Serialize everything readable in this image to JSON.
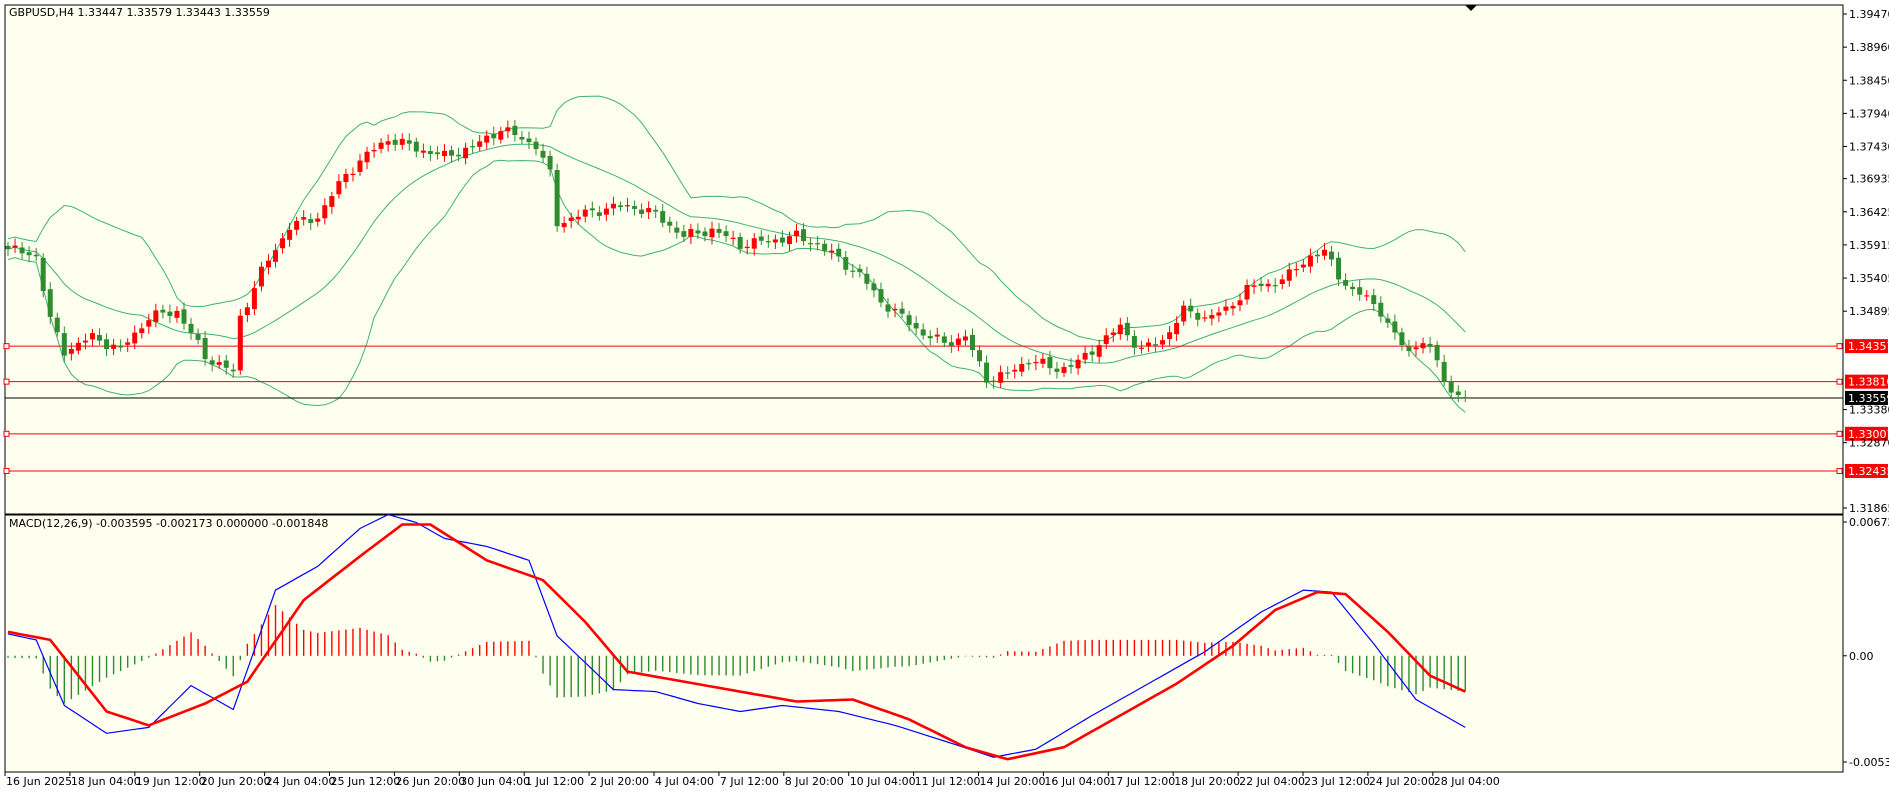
{
  "colors": {
    "background": "#fffff0",
    "bull": "#ff0000",
    "bear": "#2e8b2e",
    "bands": "#3cb371",
    "level": "#ff0000",
    "current_price": "#000000",
    "macd_line": "#0000ff",
    "signal_line": "#ff0000"
  },
  "chart_data": {
    "type": "candlestick",
    "symbol_header": "GBPUSD,H4  1.33447 1.33579 1.33443 1.33559",
    "ylim": [
      1.31865,
      1.3947
    ],
    "y_ticks": [
      "1.39470",
      "1.38960",
      "1.38450",
      "1.37940",
      "1.37430",
      "1.36935",
      "1.36425",
      "1.35915",
      "1.35405",
      "1.34895",
      "1.33380",
      "1.32870",
      "1.31865"
    ],
    "current_price": "1.33559",
    "levels": [
      "1.34357",
      "1.33810",
      "1.33007",
      "1.32435"
    ],
    "x_labels": [
      "16 Jun 2025",
      "18 Jun 04:00",
      "19 Jun 12:00",
      "20 Jun 20:00",
      "24 Jun 04:00",
      "25 Jun 12:00",
      "26 Jun 20:00",
      "30 Jun 04:00",
      "1 Jul 12:00",
      "2 Jul 20:00",
      "4 Jul 04:00",
      "7 Jul 12:00",
      "8 Jul 20:00",
      "10 Jul 04:00",
      "11 Jul 12:00",
      "14 Jul 20:00",
      "16 Jul 04:00",
      "17 Jul 12:00",
      "18 Jul 20:00",
      "22 Jul 04:00",
      "23 Jul 12:00",
      "24 Jul 20:00",
      "28 Jul 04:00"
    ],
    "close_keypoints": [
      [
        0,
        1.3585
      ],
      [
        4,
        1.3575
      ],
      [
        6,
        1.3475
      ],
      [
        8,
        1.3428
      ],
      [
        12,
        1.345
      ],
      [
        16,
        1.343
      ],
      [
        20,
        1.348
      ],
      [
        24,
        1.349
      ],
      [
        28,
        1.342
      ],
      [
        32,
        1.3395
      ],
      [
        33,
        1.348
      ],
      [
        36,
        1.355
      ],
      [
        40,
        1.362
      ],
      [
        44,
        1.3635
      ],
      [
        48,
        1.37
      ],
      [
        51,
        1.373
      ],
      [
        54,
        1.3755
      ],
      [
        58,
        1.374
      ],
      [
        62,
        1.3728
      ],
      [
        66,
        1.3742
      ],
      [
        70,
        1.377
      ],
      [
        72,
        1.376
      ],
      [
        75,
        1.3745
      ],
      [
        77,
        1.37
      ],
      [
        78,
        1.3625
      ],
      [
        82,
        1.364
      ],
      [
        86,
        1.365
      ],
      [
        89,
        1.365
      ],
      [
        92,
        1.3638
      ],
      [
        96,
        1.3605
      ],
      [
        100,
        1.3615
      ],
      [
        104,
        1.3592
      ],
      [
        108,
        1.3598
      ],
      [
        112,
        1.3605
      ],
      [
        115,
        1.3592
      ],
      [
        118,
        1.357
      ],
      [
        121,
        1.3545
      ],
      [
        124,
        1.3505
      ],
      [
        127,
        1.348
      ],
      [
        130,
        1.3455
      ],
      [
        133,
        1.344
      ],
      [
        136,
        1.345
      ],
      [
        139,
        1.3385
      ],
      [
        142,
        1.3392
      ],
      [
        145,
        1.3415
      ],
      [
        149,
        1.34
      ],
      [
        152,
        1.341
      ],
      [
        155,
        1.344
      ],
      [
        158,
        1.3465
      ],
      [
        161,
        1.343
      ],
      [
        164,
        1.3445
      ],
      [
        167,
        1.349
      ],
      [
        170,
        1.348
      ],
      [
        173,
        1.349
      ],
      [
        176,
        1.3525
      ],
      [
        179,
        1.353
      ],
      [
        182,
        1.3545
      ],
      [
        185,
        1.3575
      ],
      [
        187,
        1.358
      ],
      [
        189,
        1.3545
      ],
      [
        191,
        1.352
      ],
      [
        193,
        1.351
      ],
      [
        195,
        1.349
      ],
      [
        197,
        1.345
      ],
      [
        199,
        1.3428
      ],
      [
        201,
        1.3445
      ],
      [
        203,
        1.341
      ],
      [
        205,
        1.3365
      ],
      [
        207,
        1.3356
      ]
    ],
    "macd": {
      "label": "MACD(12,26,9) -0.003595 -0.002173 0.000000 -0.001848",
      "ylim": [
        -0.005342,
        0.006727
      ],
      "y_ticks": [
        "0.006727",
        "0.00",
        "-0.005342"
      ],
      "macd_keypoints": [
        [
          0,
          0.0011
        ],
        [
          4,
          0.0008
        ],
        [
          8,
          -0.0025
        ],
        [
          14,
          -0.0039
        ],
        [
          20,
          -0.0036
        ],
        [
          26,
          -0.0015
        ],
        [
          32,
          -0.0027
        ],
        [
          38,
          0.0033
        ],
        [
          44,
          0.0045
        ],
        [
          50,
          0.0064
        ],
        [
          54,
          0.0071
        ],
        [
          58,
          0.0067
        ],
        [
          62,
          0.0059
        ],
        [
          68,
          0.0055
        ],
        [
          74,
          0.0048
        ],
        [
          78,
          0.001
        ],
        [
          86,
          -0.0017
        ],
        [
          92,
          -0.0018
        ],
        [
          98,
          -0.0024
        ],
        [
          104,
          -0.0028
        ],
        [
          110,
          -0.0025
        ],
        [
          118,
          -0.0028
        ],
        [
          126,
          -0.0035
        ],
        [
          134,
          -0.0044
        ],
        [
          140,
          -0.0051
        ],
        [
          146,
          -0.0047
        ],
        [
          154,
          -0.003
        ],
        [
          162,
          -0.0014
        ],
        [
          170,
          0.0002
        ],
        [
          178,
          0.0022
        ],
        [
          184,
          0.0033
        ],
        [
          188,
          0.0032
        ],
        [
          194,
          0.0006
        ],
        [
          200,
          -0.0022
        ],
        [
          207,
          -0.0036
        ]
      ],
      "signal_keypoints": [
        [
          0,
          0.0012
        ],
        [
          6,
          0.0008
        ],
        [
          14,
          -0.0028
        ],
        [
          20,
          -0.0035
        ],
        [
          28,
          -0.0024
        ],
        [
          34,
          -0.0013
        ],
        [
          42,
          0.0028
        ],
        [
          50,
          0.005
        ],
        [
          56,
          0.0066
        ],
        [
          60,
          0.0066
        ],
        [
          68,
          0.0048
        ],
        [
          76,
          0.0038
        ],
        [
          82,
          0.0017
        ],
        [
          88,
          -0.0008
        ],
        [
          96,
          -0.0013
        ],
        [
          104,
          -0.0018
        ],
        [
          112,
          -0.0023
        ],
        [
          120,
          -0.0022
        ],
        [
          128,
          -0.0032
        ],
        [
          136,
          -0.0046
        ],
        [
          142,
          -0.0052
        ],
        [
          150,
          -0.0046
        ],
        [
          158,
          -0.003
        ],
        [
          166,
          -0.0014
        ],
        [
          174,
          0.0005
        ],
        [
          180,
          0.0023
        ],
        [
          186,
          0.0032
        ],
        [
          190,
          0.0031
        ],
        [
          196,
          0.0012
        ],
        [
          202,
          -0.001
        ],
        [
          207,
          -0.0018
        ]
      ]
    }
  }
}
